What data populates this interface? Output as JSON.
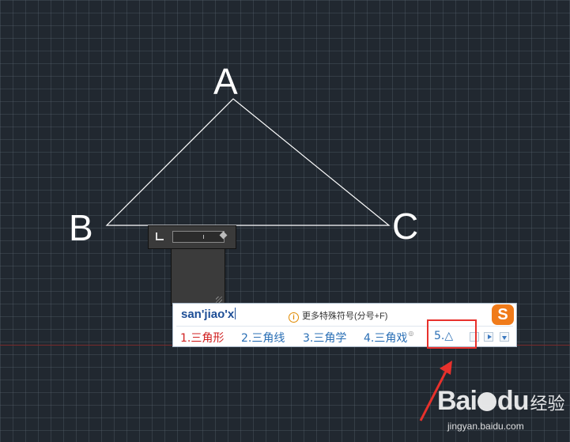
{
  "drawing": {
    "vertex_labels": [
      "A",
      "B",
      "C"
    ],
    "line_color": "#ffffff",
    "background_color": "#212830"
  },
  "cad_input": {
    "corner_icon": "angle-corner-icon",
    "handle_icon": "grip-diamond-icon"
  },
  "ime": {
    "composition": "san'jiao'x",
    "tip_icon": "info-circle-icon",
    "tip_text": "更多特殊符号(分号+F)",
    "logo": "S",
    "candidates": [
      {
        "label": "1.三角形",
        "selected": true
      },
      {
        "label": "2.三角线",
        "selected": false
      },
      {
        "label": "3.三角学",
        "selected": false
      },
      {
        "label": "4.三角戏",
        "selected": false
      },
      {
        "label": "5.△",
        "selected": false
      }
    ],
    "candidate_4_mark": "◎",
    "highlight_color": "#e8312c"
  },
  "watermark": {
    "brand": "Bai",
    "brand_suffix": "du",
    "jingyan": "经验",
    "url": "jingyan.baidu.com"
  }
}
